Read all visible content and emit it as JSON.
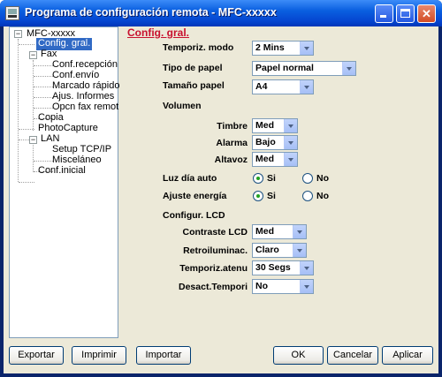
{
  "window": {
    "title": "Programa de configuración remota - MFC-xxxxx"
  },
  "titlebar_buttons": {
    "minimize_icon": "minimize-icon",
    "maximize_icon": "maximize-icon",
    "close_icon": "close-icon"
  },
  "tree": {
    "root": "MFC-xxxxx",
    "items": {
      "config_gral": "Config. gral.",
      "fax": "Fax",
      "conf_recepcion": "Conf.recepción",
      "conf_envio": "Conf.envío",
      "marcado_rapido": "Marcado rápido",
      "ajus_informes": "Ajus. Informes",
      "opcn_fax_remot": "Opcn fax remot",
      "copia": "Copia",
      "photocapture": "PhotoCapture",
      "lan": "LAN",
      "setup_tcpip": "Setup TCP/IP",
      "miscelaneo": "Misceláneo",
      "conf_inicial": "Conf.inicial"
    }
  },
  "panel": {
    "title": "Config. gral.",
    "temporiz_modo": {
      "label": "Temporiz. modo",
      "value": "2 Mins"
    },
    "tipo_papel": {
      "label": "Tipo de papel",
      "value": "Papel normal"
    },
    "tamano_papel": {
      "label": "Tamaño papel",
      "value": "A4"
    },
    "volumen": {
      "label": "Volumen",
      "timbre": {
        "label": "Timbre",
        "value": "Med"
      },
      "alarma": {
        "label": "Alarma",
        "value": "Bajo"
      },
      "altavoz": {
        "label": "Altavoz",
        "value": "Med"
      }
    },
    "luz_dia_auto": {
      "label": "Luz día auto",
      "yes": "Si",
      "no": "No",
      "selected": "Si"
    },
    "ajuste_energia": {
      "label": "Ajuste energía",
      "yes": "Si",
      "no": "No",
      "selected": "Si"
    },
    "configur_lcd": {
      "label": "Configur. LCD",
      "contraste": {
        "label": "Contraste LCD",
        "value": "Med"
      },
      "retroiluminac": {
        "label": "Retroiluminac.",
        "value": "Claro"
      },
      "temporiz_atenu": {
        "label": "Temporiz.atenu",
        "value": "30 Segs"
      },
      "desact_tempori": {
        "label": "Desact.Tempori",
        "value": "No"
      }
    }
  },
  "buttons": {
    "exportar": "Exportar",
    "imprimir": "Imprimir",
    "importar": "Importar",
    "ok": "OK",
    "cancelar": "Cancelar",
    "aplicar": "Aplicar"
  },
  "colors": {
    "titlebar": "#0A5FE0",
    "section_title": "#C8102E",
    "selection": "#316AC5",
    "client_bg": "#ECE9D8"
  }
}
